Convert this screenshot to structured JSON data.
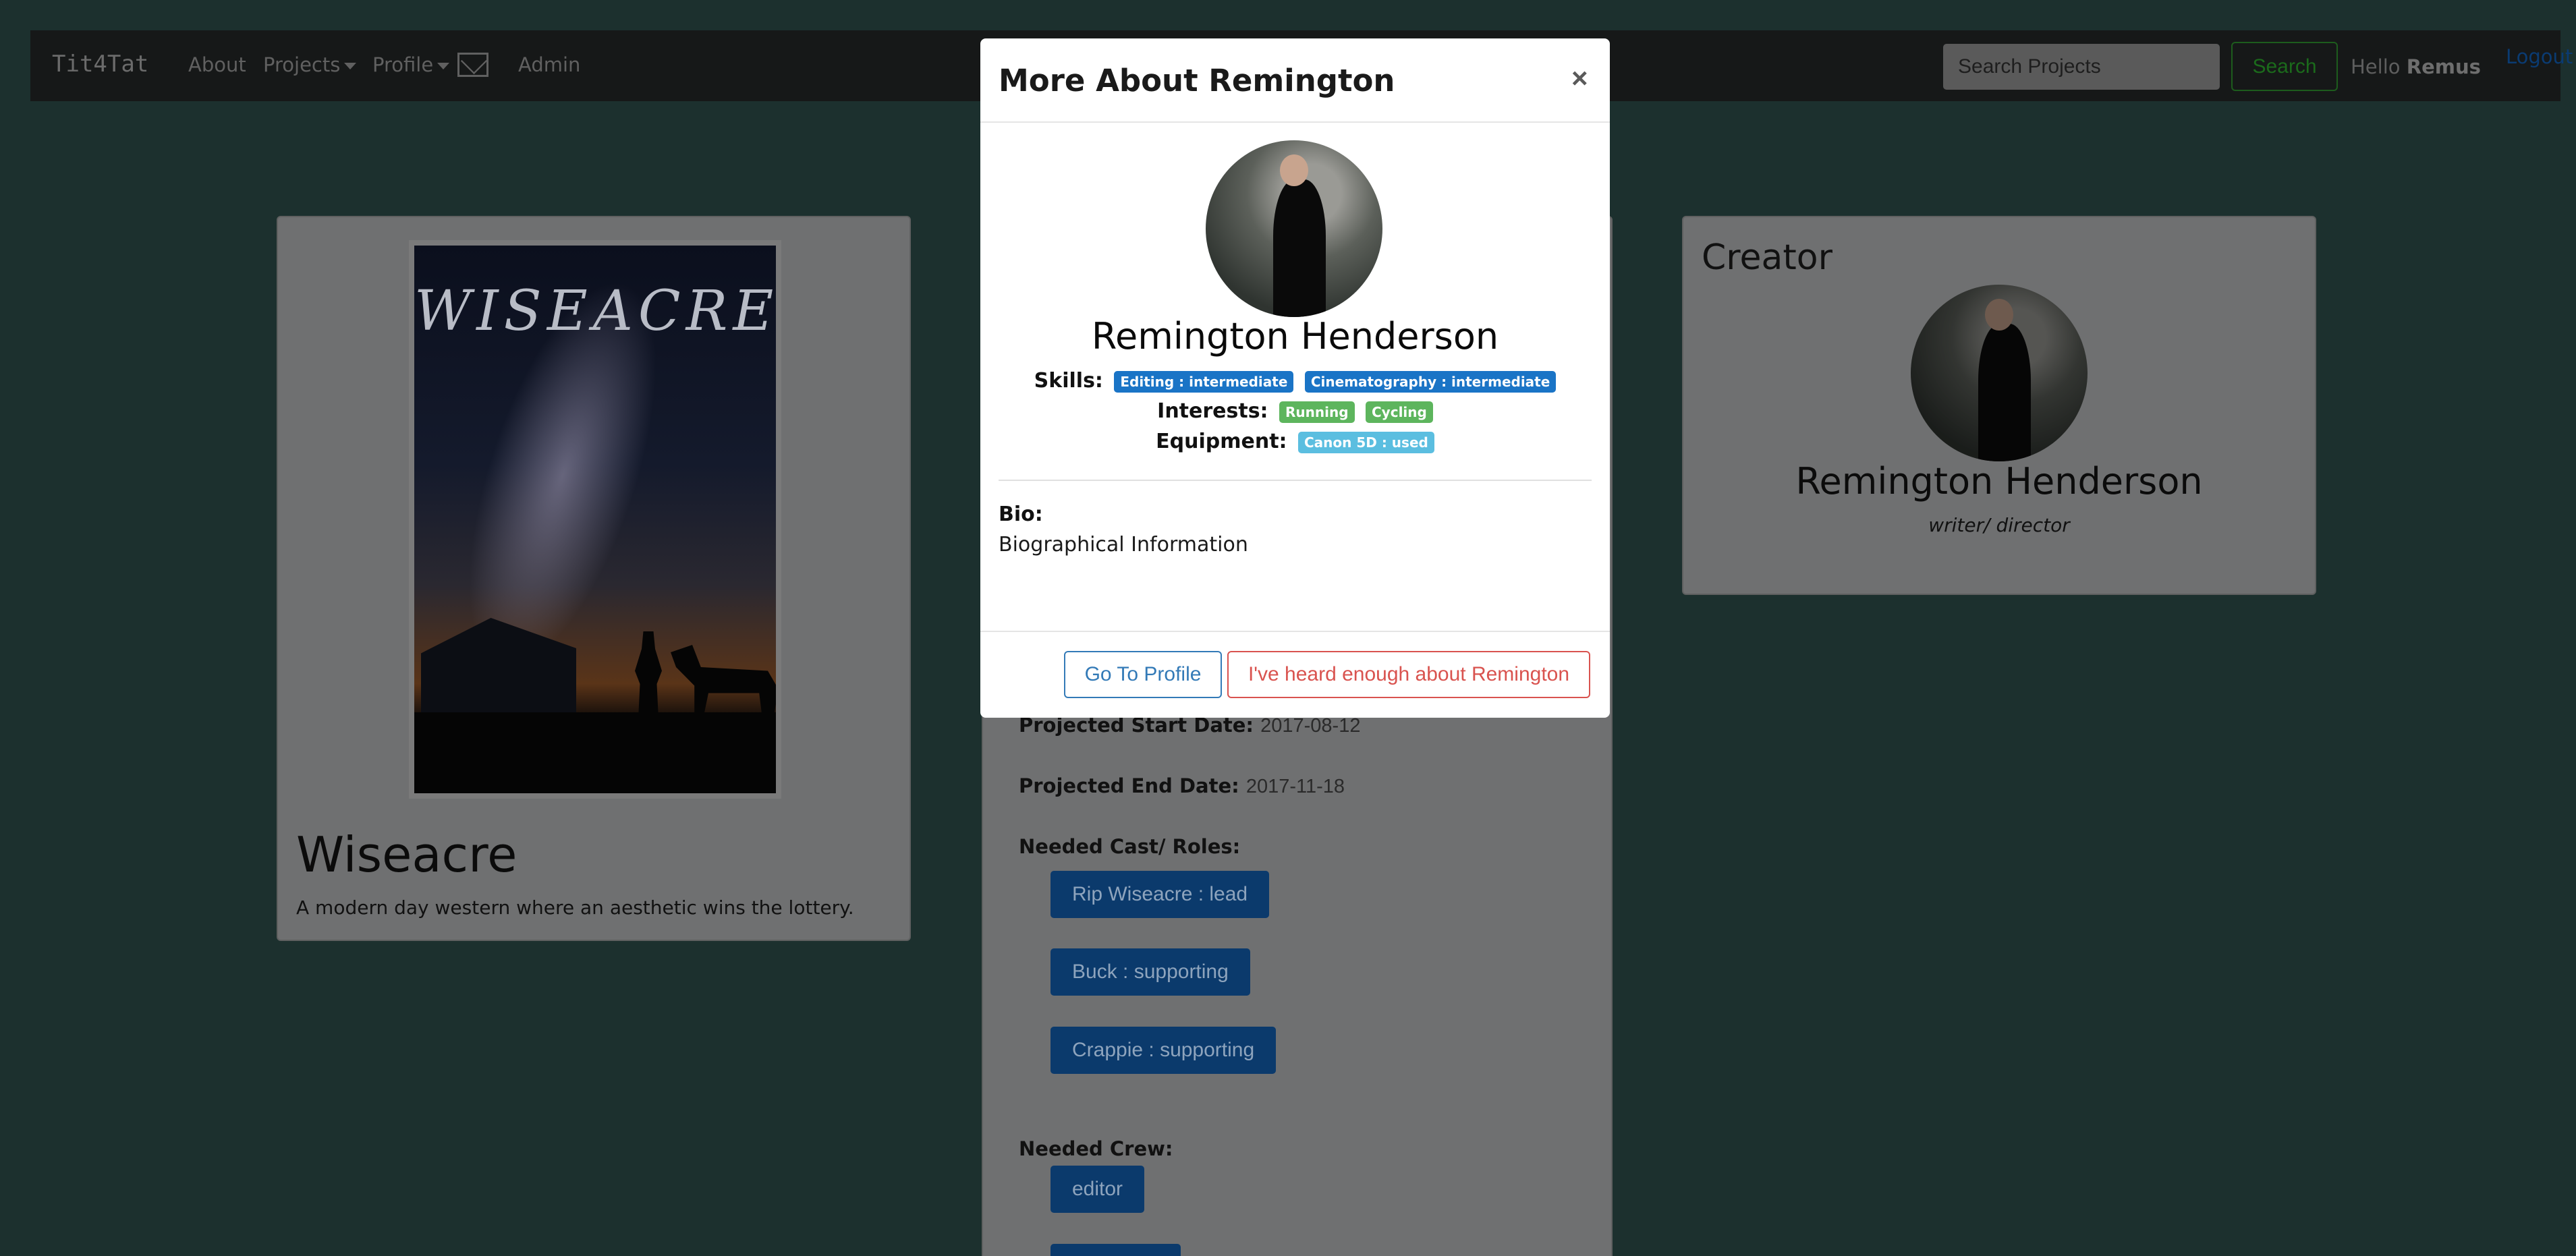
{
  "navbar": {
    "brand": "Tit4Tat",
    "about": "About",
    "projects": "Projects",
    "profile": "Profile",
    "admin": "Admin",
    "search_placeholder": "Search Projects",
    "search_button": "Search",
    "hello": "Hello",
    "username": "Remus",
    "logout": "Logout"
  },
  "project": {
    "poster_title": "WISEACRE",
    "title": "Wiseacre",
    "description": "A modern day western where an aesthetic wins the lottery.",
    "start_label": "Projected Start Date:",
    "start_date": "2017-08-12",
    "end_label": "Projected End Date:",
    "end_date": "2017-11-18",
    "cast_label": "Needed Cast/ Roles:",
    "cast": [
      "Rip Wiseacre : lead",
      "Buck : supporting",
      "Crappie : supporting"
    ],
    "crew_label": "Needed Crew:",
    "crew": [
      "editor"
    ]
  },
  "creator": {
    "heading": "Creator",
    "name": "Remington Henderson",
    "role": "writer/ director"
  },
  "modal": {
    "title": "More About Remington",
    "close": "×",
    "name": "Remington Henderson",
    "skills_label": "Skills:",
    "skills": [
      "Editing : intermediate",
      "Cinematography : intermediate"
    ],
    "interests_label": "Interests:",
    "interests": [
      "Running",
      "Cycling"
    ],
    "equipment_label": "Equipment:",
    "equipment": [
      "Canon 5D : used"
    ],
    "bio_label": "Bio:",
    "bio": "Biographical Information",
    "go_to_profile": "Go To Profile",
    "dismiss": "I've heard enough about Remington"
  },
  "colors": {
    "backdrop": "#1c302e",
    "primary": "#337ab7",
    "danger": "#d9534f",
    "skill_tag": "#1a74c6",
    "interest_tag": "#5db55d",
    "equipment_tag": "#5bbee0"
  }
}
